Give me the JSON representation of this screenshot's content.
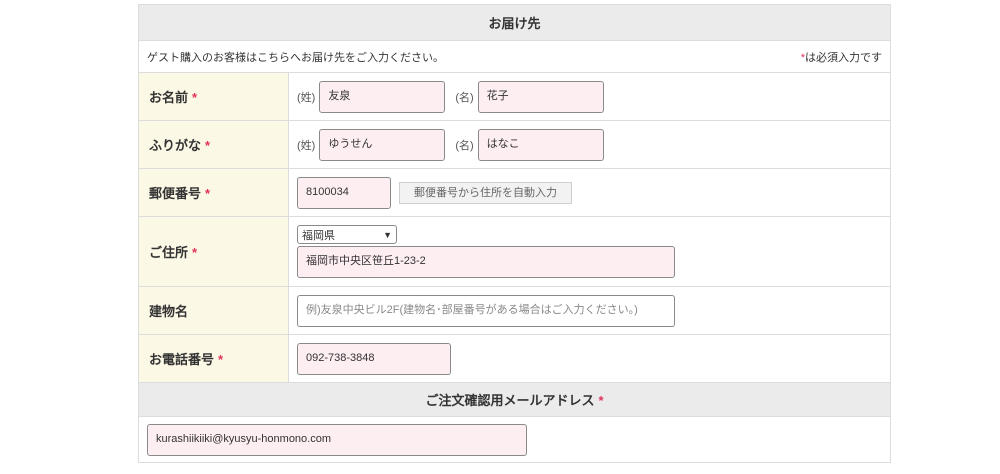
{
  "section_title": "お届け先",
  "note_left": "ゲスト購入のお客様はこちらへお届け先をご入力ください。",
  "note_right_mark": "*",
  "note_right": "は必須入力です",
  "required_mark": "*",
  "name": {
    "label": "お名前",
    "last_prefix": "(姓)",
    "last_value": "友泉",
    "first_prefix": "(名)",
    "first_value": "花子"
  },
  "kana": {
    "label": "ふりがな",
    "last_prefix": "(姓)",
    "last_value": "ゆうせん",
    "first_prefix": "(名)",
    "first_value": "はなこ"
  },
  "postal": {
    "label": "郵便番号",
    "value": "8100034",
    "button_label": "郵便番号から住所を自動入力"
  },
  "address": {
    "label": "ご住所",
    "prefecture": "福岡県",
    "value": "福岡市中央区笹丘1-23-2"
  },
  "building": {
    "label": "建物名",
    "placeholder": "例)友泉中央ビル2F(建物名･部屋番号がある場合はご入力ください。)"
  },
  "phone": {
    "label": "お電話番号",
    "value": "092-738-3848"
  },
  "email": {
    "section_title": "ご注文確認用メールアドレス",
    "value": "kurashiikiiki@kyusyu-honmono.com"
  }
}
